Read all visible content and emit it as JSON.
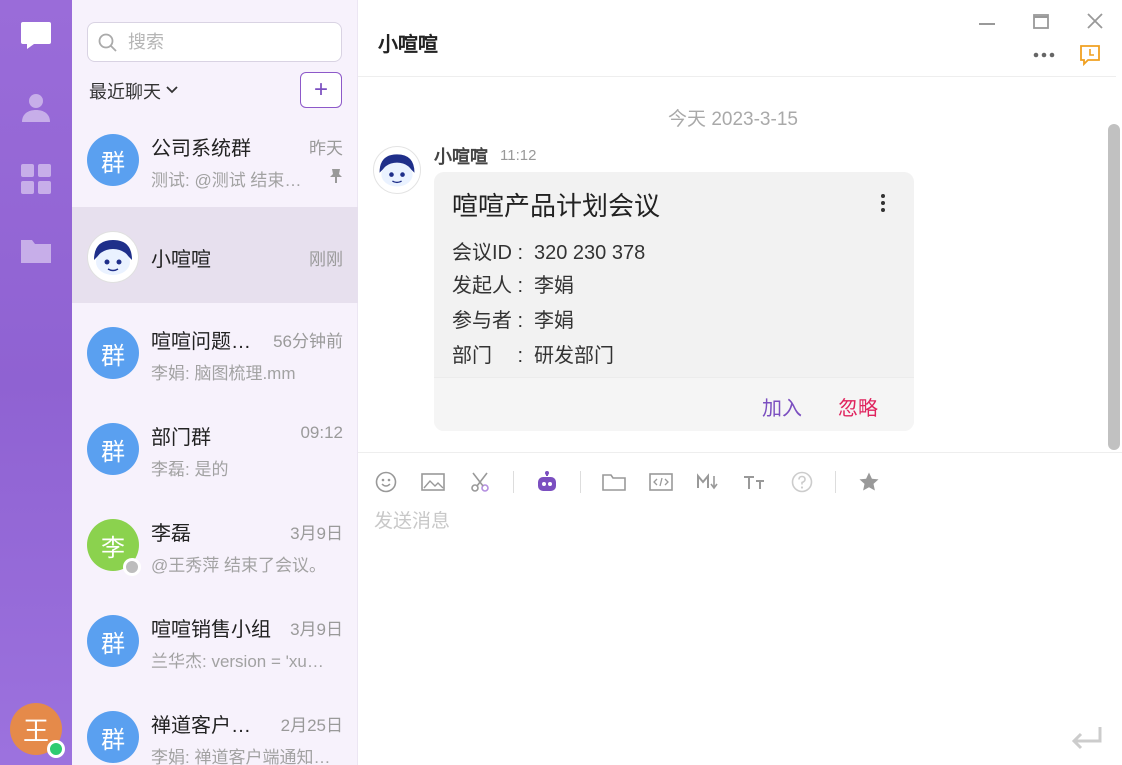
{
  "colors": {
    "accent": "#7b4fc0",
    "rail": "#9a6cd9",
    "group_avatar": "#5aa0f0",
    "ignore": "#e0245e",
    "online": "#2ecc71"
  },
  "rail": {
    "icons": [
      "chat-bubble-icon",
      "contacts-icon",
      "apps-grid-icon",
      "folder-icon"
    ],
    "user_avatar": "王"
  },
  "list": {
    "search_placeholder": "搜索",
    "recent_label": "最近聊天",
    "conversations": [
      {
        "avatar": "群",
        "name": "公司系统群",
        "time": "昨天",
        "preview": "测试: @测试 结束了会议。",
        "pinned": true
      },
      {
        "avatar": "face",
        "name": "小喧喧",
        "time": "刚刚",
        "preview": ""
      },
      {
        "avatar": "群",
        "name": "喧喧问题反馈群",
        "time": "56分钟前",
        "preview": "李娟: 脑图梳理.mm"
      },
      {
        "avatar": "群",
        "name": "部门群",
        "time": "09:12",
        "preview": "李磊: 是的"
      },
      {
        "avatar": "李",
        "name": "李磊",
        "time": "3月9日",
        "preview": "@王秀萍 结束了会议。"
      },
      {
        "avatar": "群",
        "name": "喧喧销售小组",
        "time": "3月9日",
        "preview": "兰华杰: version = 'xuanxuan'"
      },
      {
        "avatar": "群",
        "name": "禅道客户端群",
        "time": "2月25日",
        "preview": "李娟: 禅道客户端通知消息"
      }
    ]
  },
  "chat": {
    "title": "小喧喧",
    "date_separator": "今天 2023-3-15",
    "message": {
      "sender": "小喧喧",
      "time": "11:12",
      "card": {
        "title": "喧喧产品计划会议",
        "rows": [
          {
            "key": "会议ID :",
            "value": "320 230 378"
          },
          {
            "key": "发起人 :",
            "value": "李娟"
          },
          {
            "key": "参与者 :",
            "value": "李娟"
          },
          {
            "key": "部门 　:",
            "value": "研发部门"
          }
        ],
        "join": "加入",
        "ignore": "忽略"
      }
    },
    "input_placeholder": "发送消息",
    "toolbar_icons": [
      "emoji-icon",
      "image-icon",
      "screenshot-icon",
      "robot-icon",
      "folder-icon",
      "code-icon",
      "markdown-icon",
      "font-size-icon",
      "help-icon",
      "star-icon"
    ]
  }
}
